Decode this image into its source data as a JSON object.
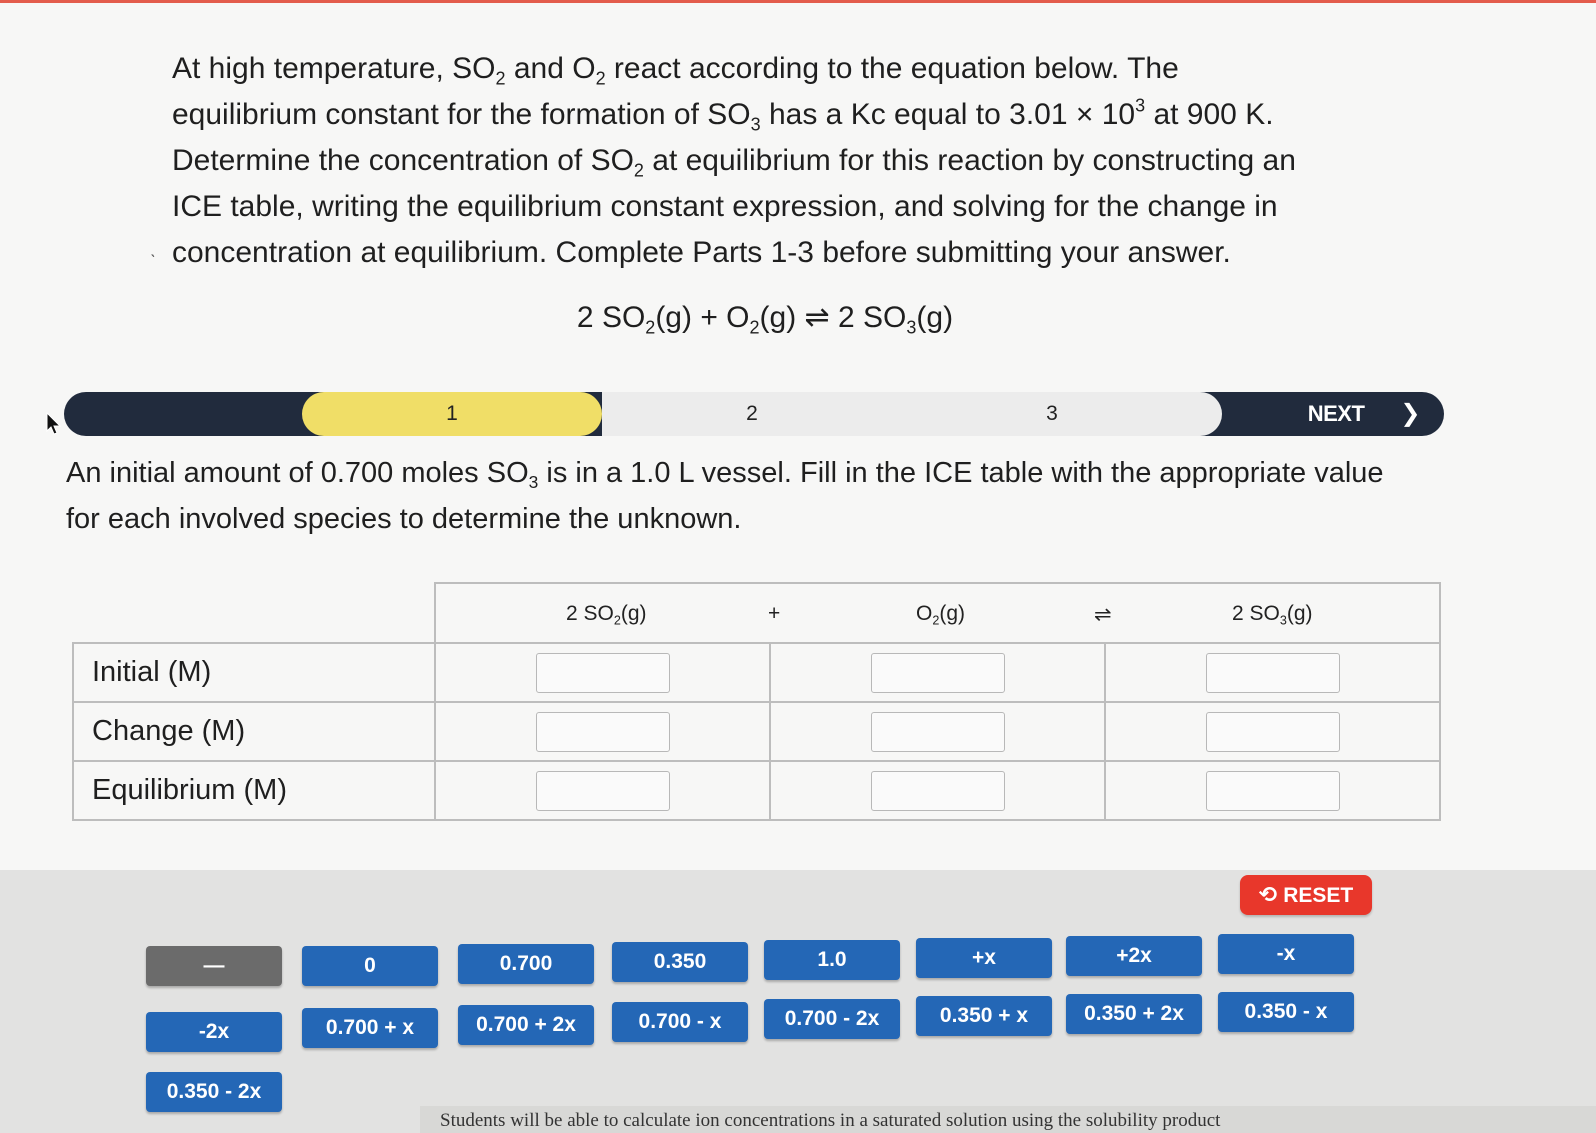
{
  "question": {
    "parts": [
      {
        "t": "At high temperature, SO"
      },
      {
        "sub": "2"
      },
      {
        "t": " and O"
      },
      {
        "sub": "2"
      },
      {
        "t": " react according to the equation below. The equilibrium constant for the formation of SO"
      },
      {
        "sub": "3"
      },
      {
        "t": " has a Kc equal to 3.01 × 10"
      },
      {
        "sup": "3"
      },
      {
        "t": " at 900 K. Determine the concentration of SO"
      },
      {
        "sub": "2"
      },
      {
        "t": " at equilibrium for this reaction by constructing an ICE table, writing the equilibrium constant expression, and solving for the change in concentration at equilibrium. Complete Parts 1-3 before submitting your answer."
      }
    ]
  },
  "equation": {
    "parts": [
      {
        "t": "2 SO"
      },
      {
        "sub": "2"
      },
      {
        "t": "(g) + O"
      },
      {
        "sub": "2"
      },
      {
        "t": "(g) ⇌ 2 SO"
      },
      {
        "sub": "3"
      },
      {
        "t": "(g)"
      }
    ]
  },
  "progress": {
    "steps": [
      "1",
      "2",
      "3"
    ],
    "active_step": "1",
    "next_label": "NEXT",
    "next_icon": "chevron-right-icon"
  },
  "prompt": {
    "parts": [
      {
        "t": "An initial amount of 0.700 moles SO"
      },
      {
        "sub": "3"
      },
      {
        "t": " is in a 1.0 L vessel. Fill in the ICE table with the appropriate value for each involved species to determine the unknown."
      }
    ]
  },
  "ice_table": {
    "headers": {
      "species1": {
        "pre": "2 SO",
        "sub": "2",
        "post": "(g)"
      },
      "plus": "+",
      "species2": {
        "pre": "O",
        "sub": "2",
        "post": "(g)"
      },
      "arrow": "⇌",
      "species3": {
        "pre": "2 SO",
        "sub": "3",
        "post": "(g)"
      }
    },
    "rows": [
      "Initial (M)",
      "Change (M)",
      "Equilibrium (M)"
    ]
  },
  "reset": {
    "label": "RESET",
    "icon": "undo-icon",
    "color": "#e8372b"
  },
  "tiles": [
    "—",
    "0",
    "0.700",
    "0.350",
    "1.0",
    "+x",
    "+2x",
    "-x",
    "-2x",
    "0.700 + x",
    "0.700 + 2x",
    "0.700 - x",
    "0.700 - 2x",
    "0.350 + x",
    "0.350 + 2x",
    "0.350 - x",
    "0.350 - 2x"
  ],
  "colors": {
    "tile": "#2467b6",
    "active_step": "#f0de67",
    "progress_bar": "#212b3d"
  },
  "footer_text": "Students will be able to calculate ion concentrations in a saturated solution using the solubility product"
}
